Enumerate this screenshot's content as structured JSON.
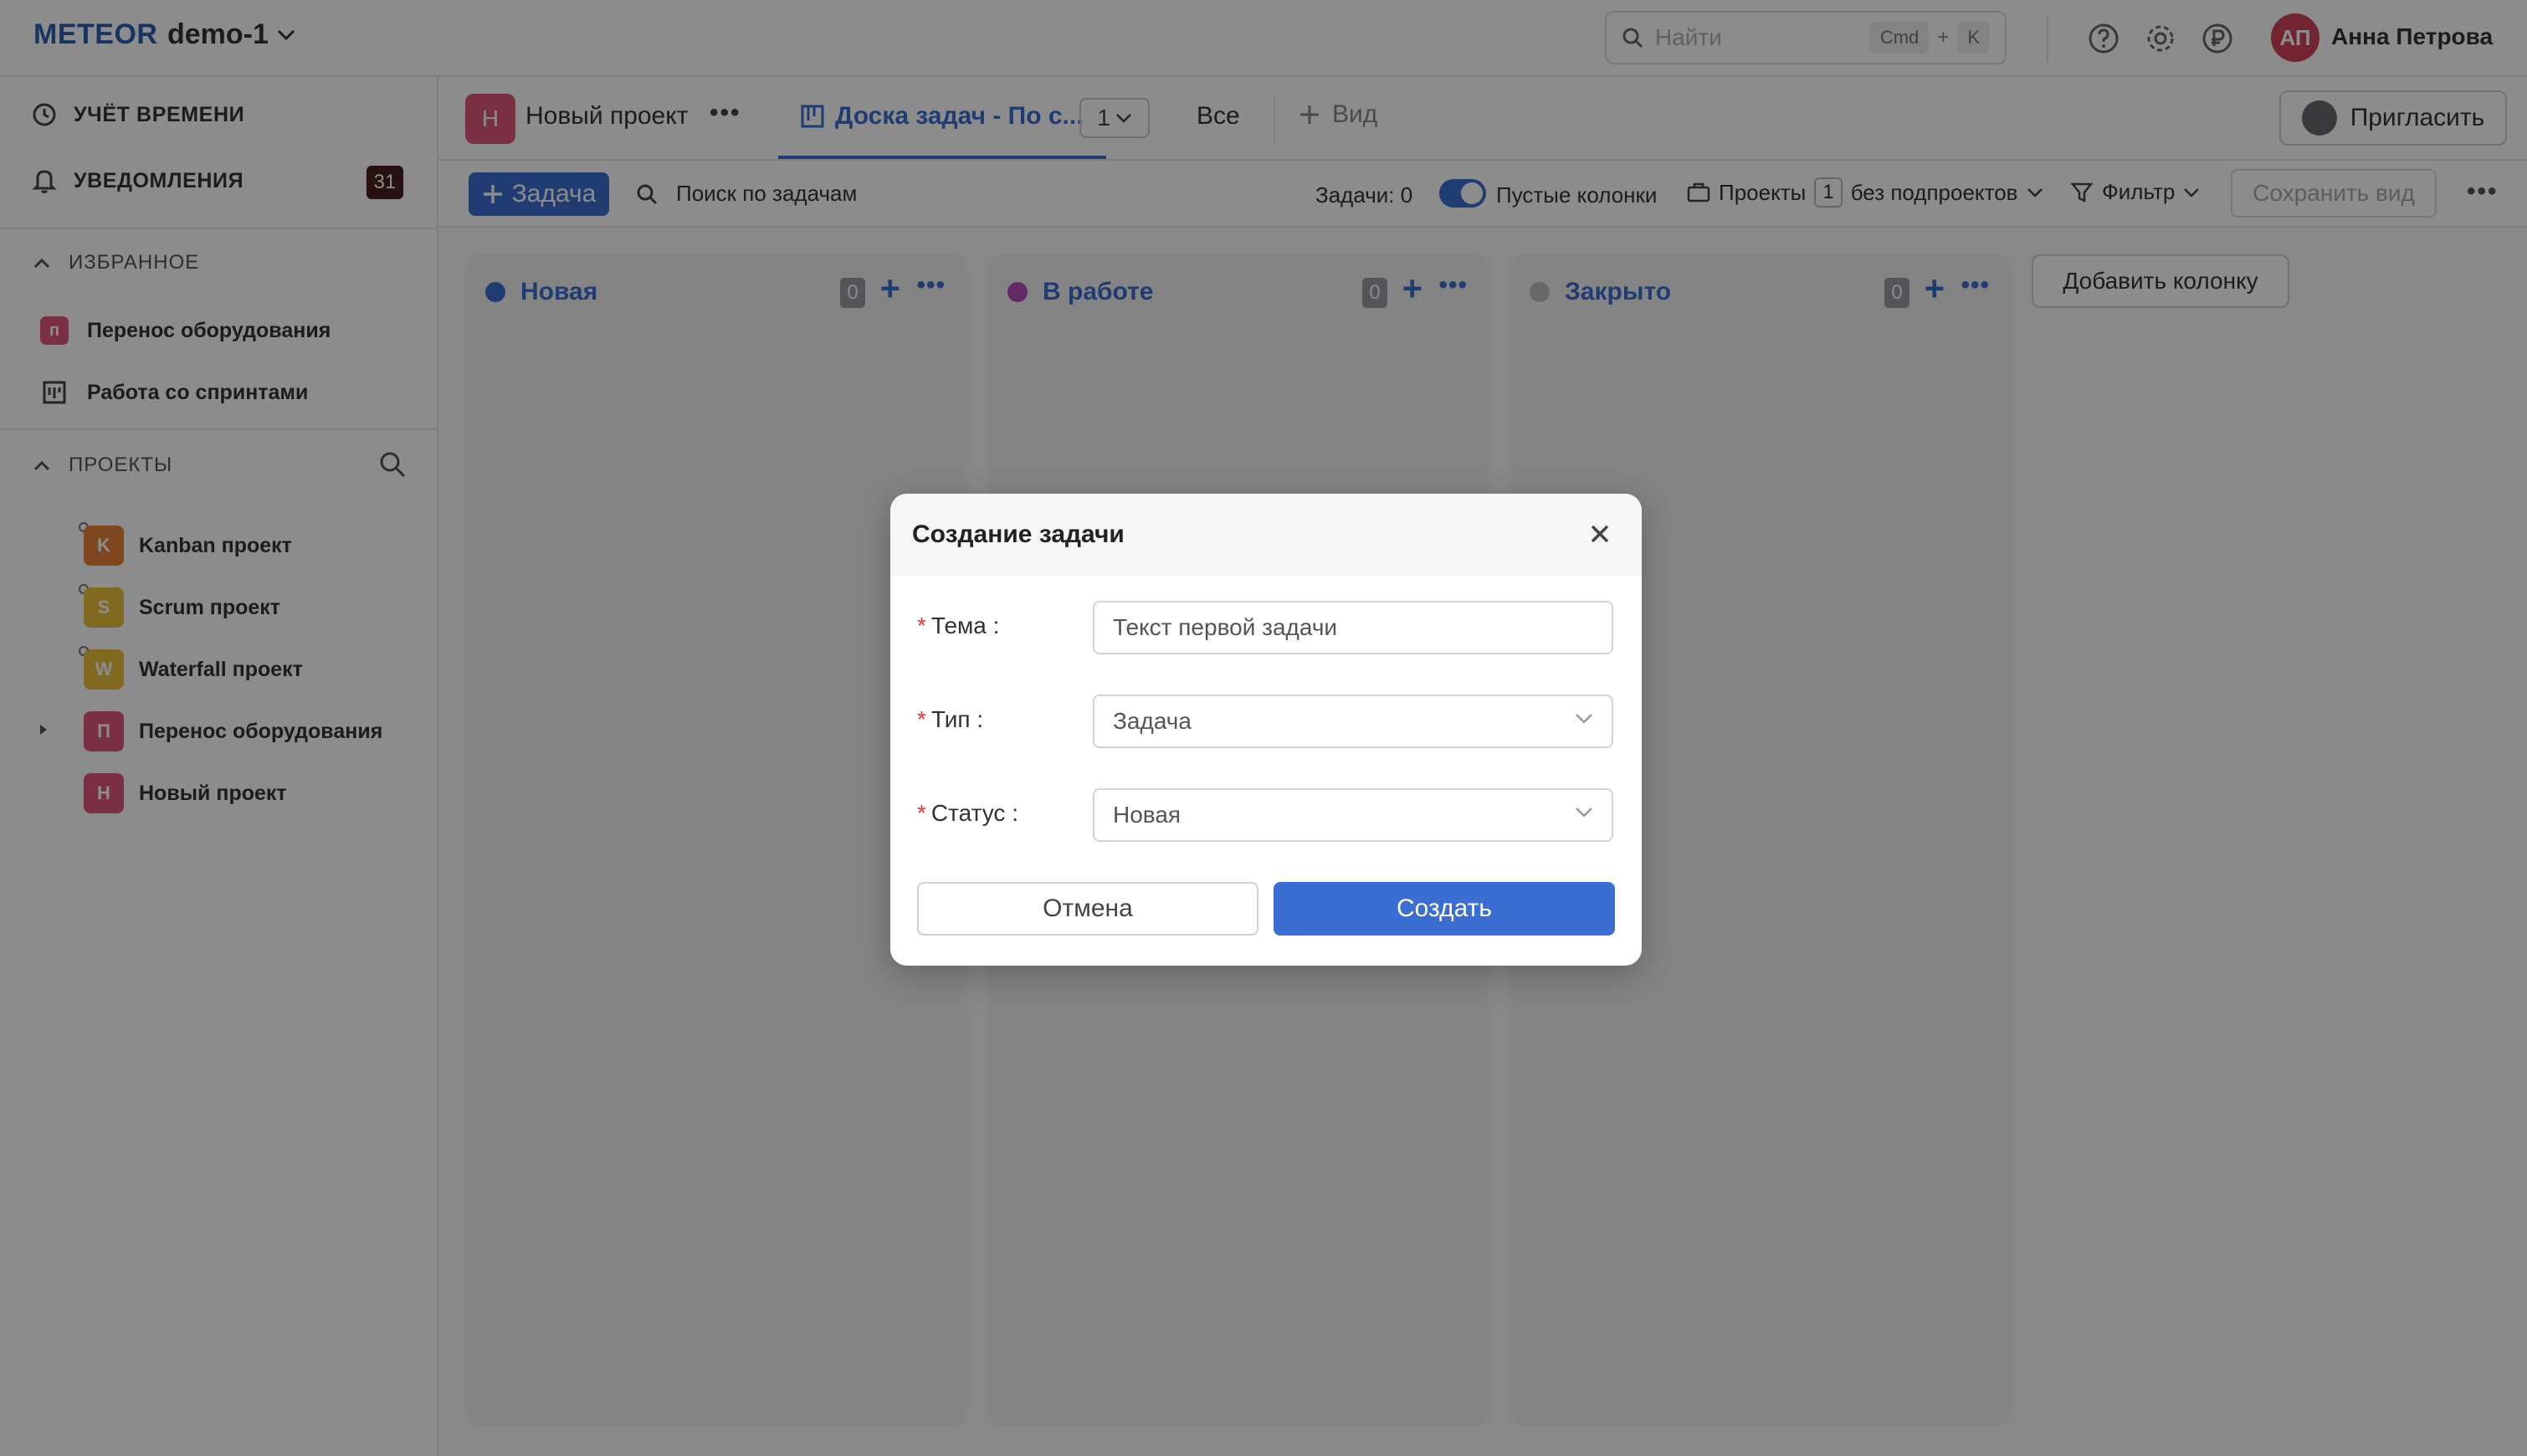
{
  "app": {
    "brand": "METEOR",
    "workspace": "demo-1"
  },
  "topbar": {
    "search_placeholder": "Найти",
    "kbd_cmd": "Cmd",
    "kbd_plus": "+",
    "kbd_k": "K",
    "user_initials": "АП",
    "user_name": "Анна Петрова",
    "icons": [
      "help-icon",
      "settings-icon",
      "ruble-icon"
    ]
  },
  "sidebar": {
    "time_tracking": "УЧЁТ ВРЕМЕНИ",
    "notifications": "УВЕДОМЛЕНИЯ",
    "notifications_count": "31",
    "favorites_title": "ИЗБРАННОЕ",
    "favorites": [
      {
        "icon_text": "п",
        "label": "Перенос оборудования",
        "color": "#e0567b"
      },
      {
        "icon_text": "",
        "label": "Работа со спринтами"
      }
    ],
    "projects_title": "ПРОЕКТЫ",
    "projects": [
      {
        "letter": "K",
        "label": "Kanban проект",
        "color": "#e8823a"
      },
      {
        "letter": "S",
        "label": "Scrum проект",
        "color": "#e8c13a"
      },
      {
        "letter": "W",
        "label": "Waterfall проект",
        "color": "#e8c13a"
      },
      {
        "letter": "П",
        "label": "Перенос оборудования",
        "color": "#e0567b"
      },
      {
        "letter": "Н",
        "label": "Новый проект",
        "color": "#e0567b"
      }
    ]
  },
  "header": {
    "project_letter": "Н",
    "project_title": "Новый проект",
    "active_tab": "Доска задач - По с...",
    "tab_number": "1",
    "tab_all": "Все",
    "tab_view": "Вид",
    "invite": "Пригласить"
  },
  "toolbar": {
    "add_task": "Задача",
    "search_tasks": "Поиск по задачам",
    "tasks_count": "Задачи: 0",
    "empty_columns": "Пустые колонки",
    "projects_label": "Проекты",
    "projects_num": "1",
    "without_subprojects": "без подпроектов",
    "filter": "Фильтр",
    "save_view": "Сохранить вид"
  },
  "board": {
    "columns": [
      {
        "title": "Новая",
        "count": "0",
        "color": "#3b6ed0"
      },
      {
        "title": "В работе",
        "count": "0",
        "color": "#b34fb8"
      },
      {
        "title": "Закрыто",
        "count": "0",
        "color": "#bdbdc2"
      }
    ],
    "add_column": "Добавить колонку"
  },
  "modal": {
    "title": "Создание задачи",
    "fields": [
      {
        "label": "Тема",
        "value": "Текст первой задачи"
      },
      {
        "label": "Тип",
        "value": "Задача"
      },
      {
        "label": "Статус",
        "value": "Новая"
      }
    ],
    "cancel": "Отмена",
    "create": "Создать"
  }
}
